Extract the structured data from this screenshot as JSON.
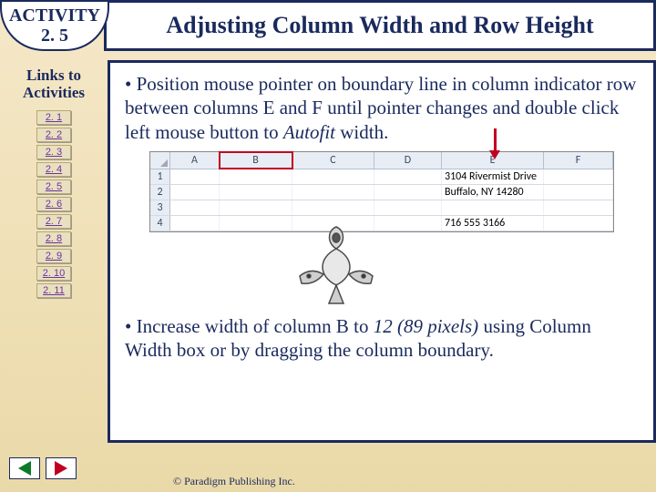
{
  "activity": {
    "label1": "ACTIVITY",
    "label2": "2. 5"
  },
  "title": "Adjusting Column Width and Row Height",
  "sidebar": {
    "heading1": "Links to",
    "heading2": "Activities",
    "links": [
      "2. 1",
      "2. 2",
      "2. 3",
      "2. 4",
      "2. 5",
      "2. 6",
      "2. 7",
      "2. 8",
      "2. 9",
      "2. 10",
      "2. 11"
    ]
  },
  "bullets": {
    "b1_pre": "• Position mouse pointer on boundary line in column indicator row between columns E and F until pointer changes and double click left mouse button to ",
    "b1_em": "Autofit",
    "b1_post": " width.",
    "b2_pre": "• Increase width of column B to ",
    "b2_em": "12 (89 pixels)",
    "b2_post": " using Column Width box or by dragging the column boundary."
  },
  "excel": {
    "cols": {
      "A": "A",
      "B": "B",
      "C": "C",
      "D": "D",
      "E": "E",
      "F": "F"
    },
    "rows": [
      "1",
      "2",
      "3",
      "4"
    ],
    "e1": "3104 Rivermist Drive",
    "e2": "Buffalo, NY 14280",
    "e3": "",
    "e4": "716 555 3166"
  },
  "footer": {
    "copyright": "© Paradigm Publishing Inc."
  }
}
